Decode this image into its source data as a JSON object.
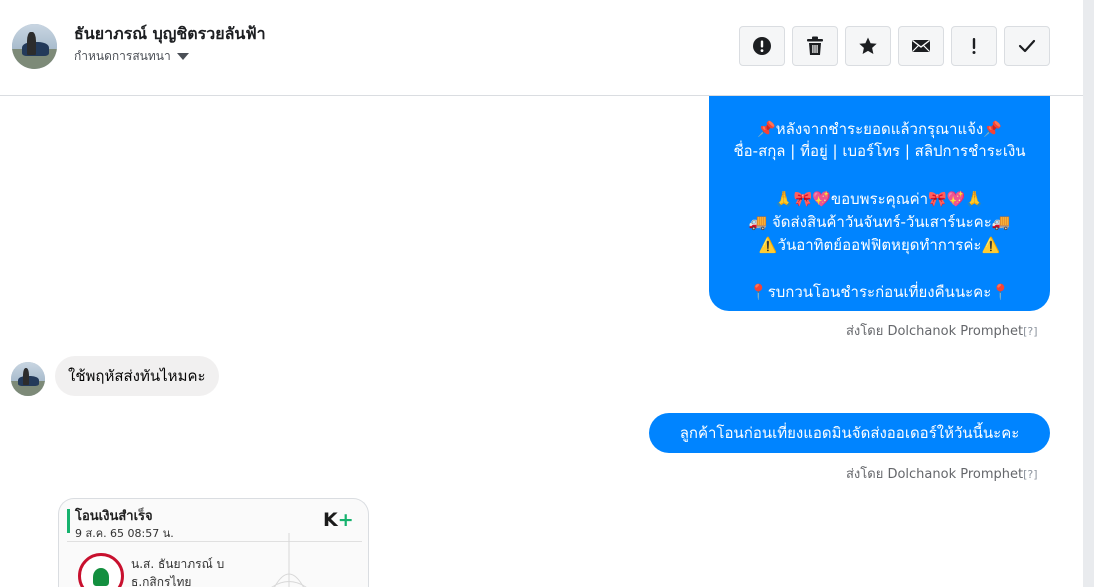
{
  "header": {
    "contact_name": "ธันยาภรณ์ บุญชิตรวยลันฟ้า",
    "subtitle": "กำหนดการสนทนา",
    "toolbar": [
      {
        "name": "report-spam-button",
        "icon": "exclamation-circle-icon"
      },
      {
        "name": "delete-button",
        "icon": "trash-icon"
      },
      {
        "name": "star-button",
        "icon": "star-icon"
      },
      {
        "name": "mark-unread-button",
        "icon": "envelope-icon"
      },
      {
        "name": "follow-up-button",
        "icon": "exclamation-icon"
      },
      {
        "name": "mark-done-button",
        "icon": "checkmark-icon"
      }
    ]
  },
  "messages": {
    "page_message_lines": [
      "📌หลังจากชำระยอดแล้วกรุณาแจ้ง📌",
      "ชื่อ-สกุล | ที่อยู่ | เบอร์โทร | สลิปการชำระเงิน",
      "",
      "🙏🎀💖ขอบพระคุณค่า🎀💖🙏",
      "🚚 จัดส่งสินค้าวันจันทร์-วันเสาร์นะคะ🚚",
      "⚠️วันอาทิตย์ออฟฟิตหยุดทำการค่ะ⚠️",
      "",
      "📍รบกวนโอนชำระก่อนเที่ยงคืนนะคะ📍"
    ],
    "sent_by_1": "ส่งโดย Dolchanok Promphet",
    "sent_by_1_help": "[?]",
    "customer_message": "ใช้พฤหัสส่งทันไหมคะ",
    "page_reply": "ลูกค้าโอนก่อนเที่ยงแอดมินจัดส่งออเดอร์ให้วันนี้นะคะ",
    "sent_by_2": "ส่งโดย Dolchanok Promphet",
    "sent_by_2_help": "[?]"
  },
  "receipt": {
    "title": "โอนเงินสำเร็จ",
    "datetime": "9 ส.ค. 65  08:57 น.",
    "brand": "K",
    "brand_plus": "+",
    "account_name": "น.ส. ธันยาภรณ์ บ",
    "bank_name": "ธ.กสิกรไทย"
  },
  "colors": {
    "outgoing_bubble": "#0084ff",
    "incoming_bubble": "#f1f0f0",
    "toolbar_bg": "#f5f6f7",
    "brand_green": "#16b26e"
  }
}
